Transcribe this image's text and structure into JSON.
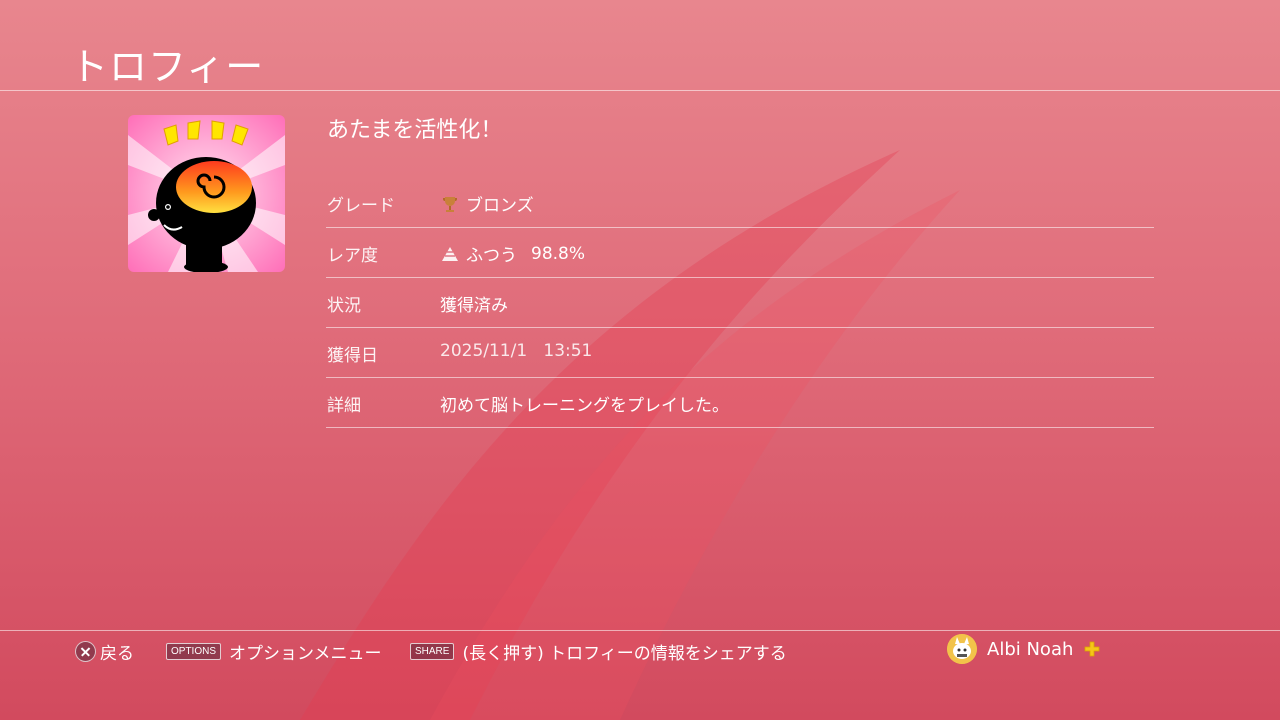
{
  "header": {
    "title": "トロフィー"
  },
  "trophy": {
    "name": "あたまを活性化！",
    "icon": "brain-head-icon",
    "rows": [
      {
        "label": "グレード",
        "value": "ブロンズ",
        "icon": "bronze-trophy-icon"
      },
      {
        "label": "レア度",
        "value": "ふつう",
        "extra": "98.8%",
        "icon": "rarity-pyramid-icon"
      },
      {
        "label": "状況",
        "value": "獲得済み"
      },
      {
        "label": "獲得日",
        "value": "2025/11/1   13:51"
      },
      {
        "label": "詳細",
        "value": "初めて脳トレーニングをプレイした。"
      }
    ]
  },
  "footer": {
    "back_label": "戻る",
    "options_key": "OPTIONS",
    "options_label": "オプションメニュー",
    "share_key": "SHARE",
    "share_label": "(長く押す) トロフィーの情報をシェアする",
    "user_name": "Albi Noah",
    "plus_icon": "ps-plus-icon"
  },
  "colors": {
    "background_top": "#e8868e",
    "background_bottom": "#d24a5e",
    "bronze": "#c9803a",
    "plus_gold": "#f5c518"
  }
}
